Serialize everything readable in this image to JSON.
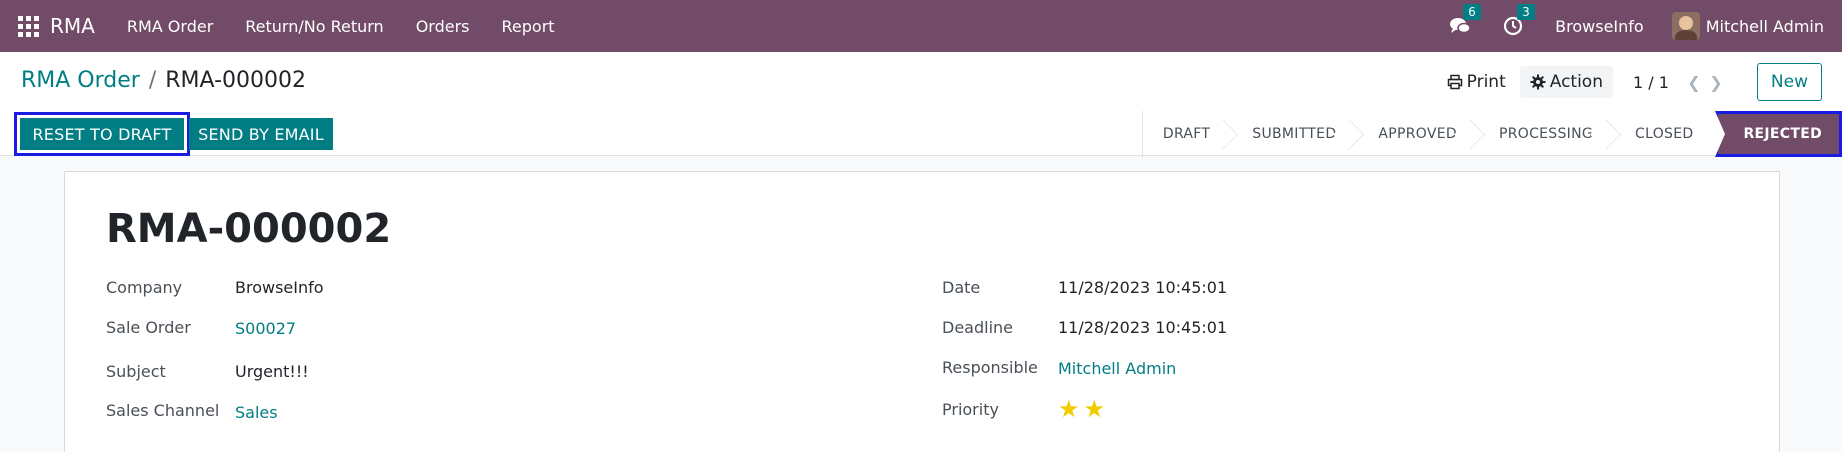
{
  "navbar": {
    "brand": "RMA",
    "menu": [
      "RMA Order",
      "Return/No Return",
      "Orders",
      "Report"
    ],
    "messages_count": "6",
    "activities_count": "3",
    "company": "BrowseInfo",
    "user": "Mitchell Admin"
  },
  "breadcrumb": {
    "parent": "RMA Order",
    "separator": "/",
    "current": "RMA-000002"
  },
  "toolbar": {
    "print_label": "Print",
    "action_label": "Action",
    "pager": "1 / 1",
    "new_label": "New"
  },
  "buttons": {
    "reset_label": "RESET TO DRAFT",
    "send_label": "SEND BY EMAIL"
  },
  "statusbar": {
    "steps": [
      "DRAFT",
      "SUBMITTED",
      "APPROVED",
      "PROCESSING",
      "CLOSED",
      "REJECTED"
    ],
    "active": "REJECTED"
  },
  "form": {
    "title": "RMA-000002",
    "left": {
      "company_label": "Company",
      "company_value": "BrowseInfo",
      "sale_order_label": "Sale Order",
      "sale_order_value": "S00027",
      "subject_label": "Subject",
      "subject_value": "Urgent!!!",
      "sales_channel_label": "Sales Channel",
      "sales_channel_value": "Sales"
    },
    "right": {
      "date_label": "Date",
      "date_value": "11/28/2023 10:45:01",
      "deadline_label": "Deadline",
      "deadline_value": "11/28/2023 10:45:01",
      "responsible_label": "Responsible",
      "responsible_value": "Mitchell Admin",
      "priority_label": "Priority",
      "priority_stars": 2
    }
  },
  "colors": {
    "navbar": "#714b67",
    "primary": "#017e84",
    "star": "#f3cc00",
    "highlight": "#1a1de0"
  }
}
